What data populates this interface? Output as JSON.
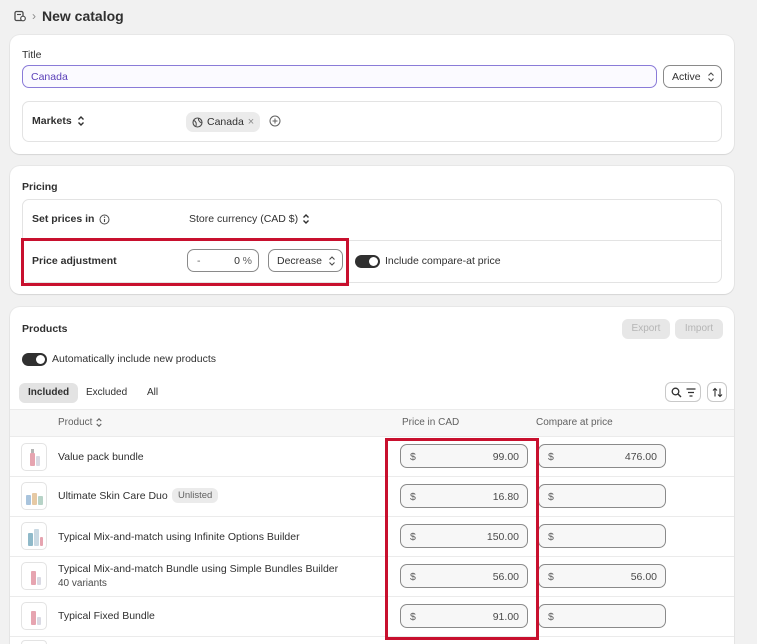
{
  "breadcrumb": {
    "icon": "catalog-icon",
    "separator": "›",
    "title": "New catalog"
  },
  "title_section": {
    "label": "Title",
    "value": "Canada",
    "status": "Active",
    "markets_label": "Markets",
    "market_tag": "Canada"
  },
  "pricing": {
    "heading": "Pricing",
    "set_prices_label": "Set prices in",
    "currency": "Store currency (CAD $)",
    "adjustment_label": "Price adjustment",
    "adjustment_sign": "-",
    "adjustment_value": "0",
    "adjustment_unit": "%",
    "adjustment_mode": "Decrease",
    "compare_at_label": "Include compare-at price",
    "compare_at_enabled": true
  },
  "products": {
    "heading": "Products",
    "export_label": "Export",
    "import_label": "Import",
    "auto_include_label": "Automatically include new products",
    "auto_include_enabled": true,
    "tabs": [
      "Included",
      "Excluded",
      "All"
    ],
    "active_tab": "Included",
    "columns": {
      "product": "Product",
      "price": "Price in CAD",
      "compare": "Compare at price"
    },
    "currency_symbol": "$",
    "rows": [
      {
        "name": "Value pack bundle",
        "badge": "",
        "sub": "",
        "price": "99.00",
        "compare": "476.00"
      },
      {
        "name": "Ultimate Skin Care Duo",
        "badge": "Unlisted",
        "sub": "",
        "price": "16.80",
        "compare": ""
      },
      {
        "name": "Typical Mix-and-match using Infinite Options Builder",
        "badge": "",
        "sub": "",
        "price": "150.00",
        "compare": ""
      },
      {
        "name": "Typical Mix-and-match Bundle using Simple Bundles Builder",
        "badge": "",
        "sub": "40 variants",
        "price": "56.00",
        "compare": "56.00"
      },
      {
        "name": "Typical Fixed Bundle",
        "badge": "",
        "sub": "",
        "price": "91.00",
        "compare": ""
      }
    ]
  },
  "colors": {
    "highlight": "#c8102e",
    "focus": "#8a7bd8"
  }
}
